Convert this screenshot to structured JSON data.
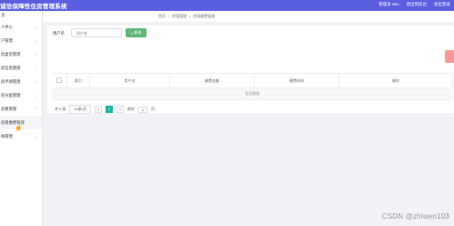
{
  "app": {
    "title": "诚信保障性住房管理系统",
    "user_greeting": "管理员 abo",
    "exit_label": "退出到前台",
    "logout_label": "退出登录"
  },
  "sidebar": {
    "header": "页",
    "items": [
      {
        "label": "人中心",
        "sub": false
      },
      {
        "label": "户管理",
        "sub": false
      },
      {
        "label": "房类型管理",
        "sub": false
      },
      {
        "label": "房信息管理",
        "sub": false
      },
      {
        "label": "房申请管理",
        "sub": false
      },
      {
        "label": "房分配管理",
        "sub": false
      },
      {
        "label": "房租管理",
        "sub": false
      },
      {
        "label": "房租缴费管理",
        "sub": true
      },
      {
        "label": "统管理",
        "sub": false
      }
    ]
  },
  "breadcrumb": {
    "items": [
      "首页",
      "/",
      "房租管理",
      "/",
      "房租缴费管理"
    ]
  },
  "search": {
    "label": "用户名",
    "placeholder": "用户名",
    "button_label": "查询"
  },
  "table": {
    "columns": [
      "索引",
      "用户名",
      "缴费金额",
      "缴费时间",
      "操作"
    ],
    "empty_text": "暂无数据"
  },
  "pagination": {
    "total_text": "共 0 条",
    "page_size": "10条/页",
    "prev": "<",
    "current": "1",
    "next": ">",
    "goto_label": "前往",
    "goto_value": "1",
    "page_suffix": "页"
  },
  "watermark": "CSDN @zhiwen103",
  "colors": {
    "topbar": "#5b5fe0",
    "search_button": "#5fb878",
    "delete_button": "#f89898",
    "pager_active": "#1fb5a0"
  }
}
